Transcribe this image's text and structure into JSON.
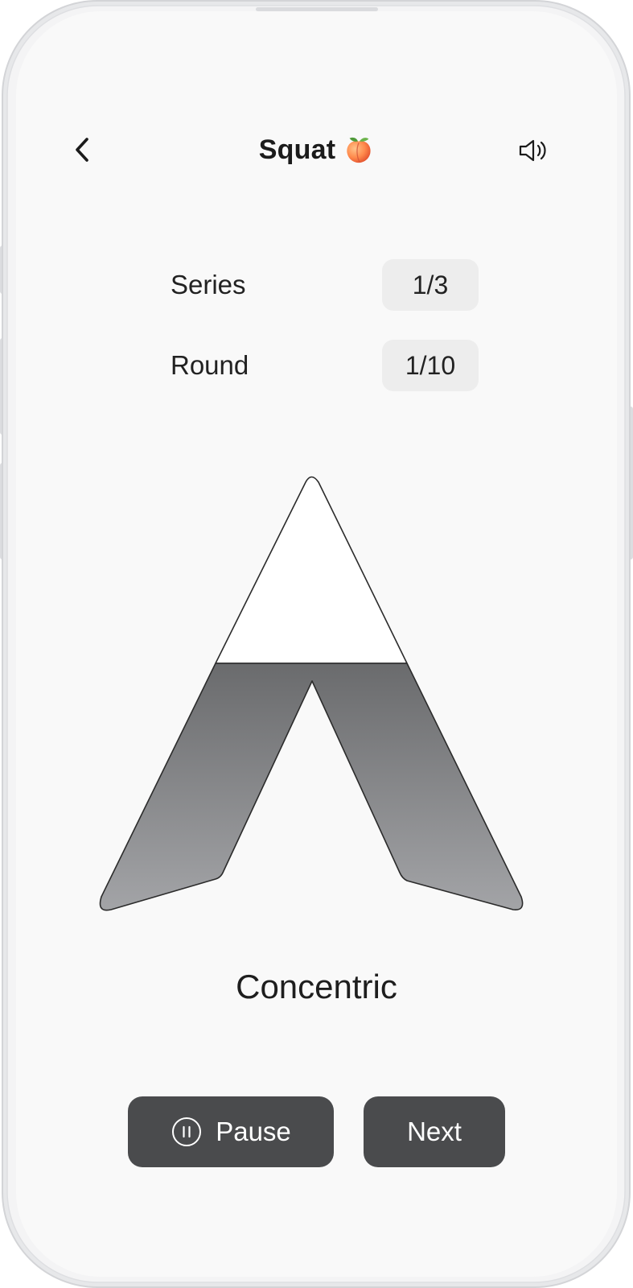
{
  "header": {
    "title": "Squat",
    "back_icon": "chevron-left-icon",
    "emoji_icon": "peach-icon",
    "sound_icon": "speaker-icon"
  },
  "stats": {
    "series_label": "Series",
    "series_value": "1/3",
    "round_label": "Round",
    "round_value": "1/10"
  },
  "movement": {
    "phase_label": "Concentric"
  },
  "controls": {
    "pause_label": "Pause",
    "pause_icon": "pause-circle-icon",
    "next_label": "Next"
  },
  "colors": {
    "background": "#f9f9f9",
    "button": "#4a4b4d",
    "badge": "#ededed",
    "fill_top": "#6a6b6d",
    "fill_bottom": "#a3a4a7"
  }
}
